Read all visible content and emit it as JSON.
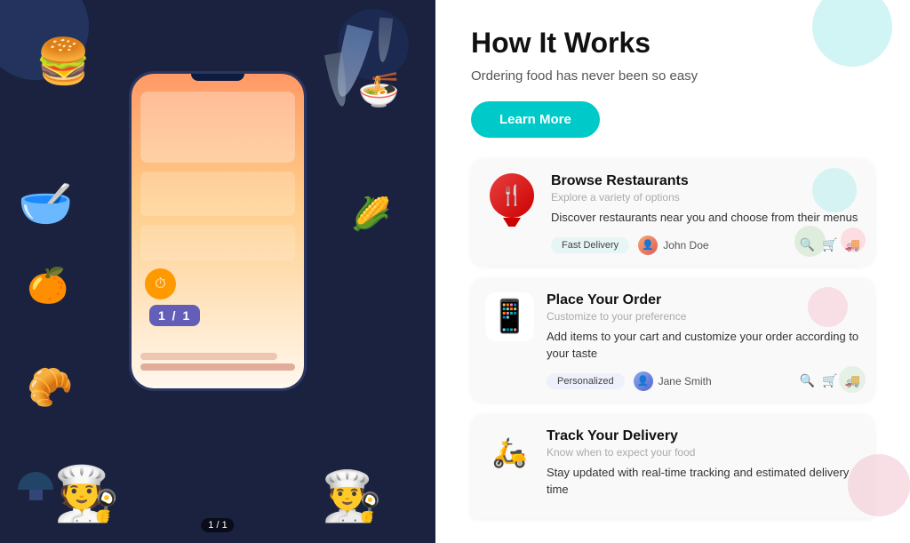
{
  "page": {
    "title": "How It Works",
    "subtitle": "Ordering food has never been so easy",
    "learn_more_label": "Learn More"
  },
  "cards": [
    {
      "id": "browse",
      "title": "Browse Restaurants",
      "subtitle": "Explore a variety of options",
      "description": "Discover restaurants near you and choose from their menus",
      "badge": "Fast Delivery",
      "user": "John Doe",
      "icon": "📍"
    },
    {
      "id": "order",
      "title": "Place Your Order",
      "subtitle": "Customize to your preference",
      "description": "Add items to your cart and customize your order according to your taste",
      "badge": "Personalized",
      "user": "Jane Smith",
      "icon": "📱"
    },
    {
      "id": "track",
      "title": "Track Your Delivery",
      "subtitle": "Know when to expect your food",
      "description": "Stay updated with real-time tracking and estimated delivery time",
      "badge": "",
      "user": "",
      "icon": "🛵"
    }
  ],
  "paginator": "1 / 1",
  "actions": {
    "search": "🔍",
    "cart": "🛒",
    "truck": "🚚"
  }
}
